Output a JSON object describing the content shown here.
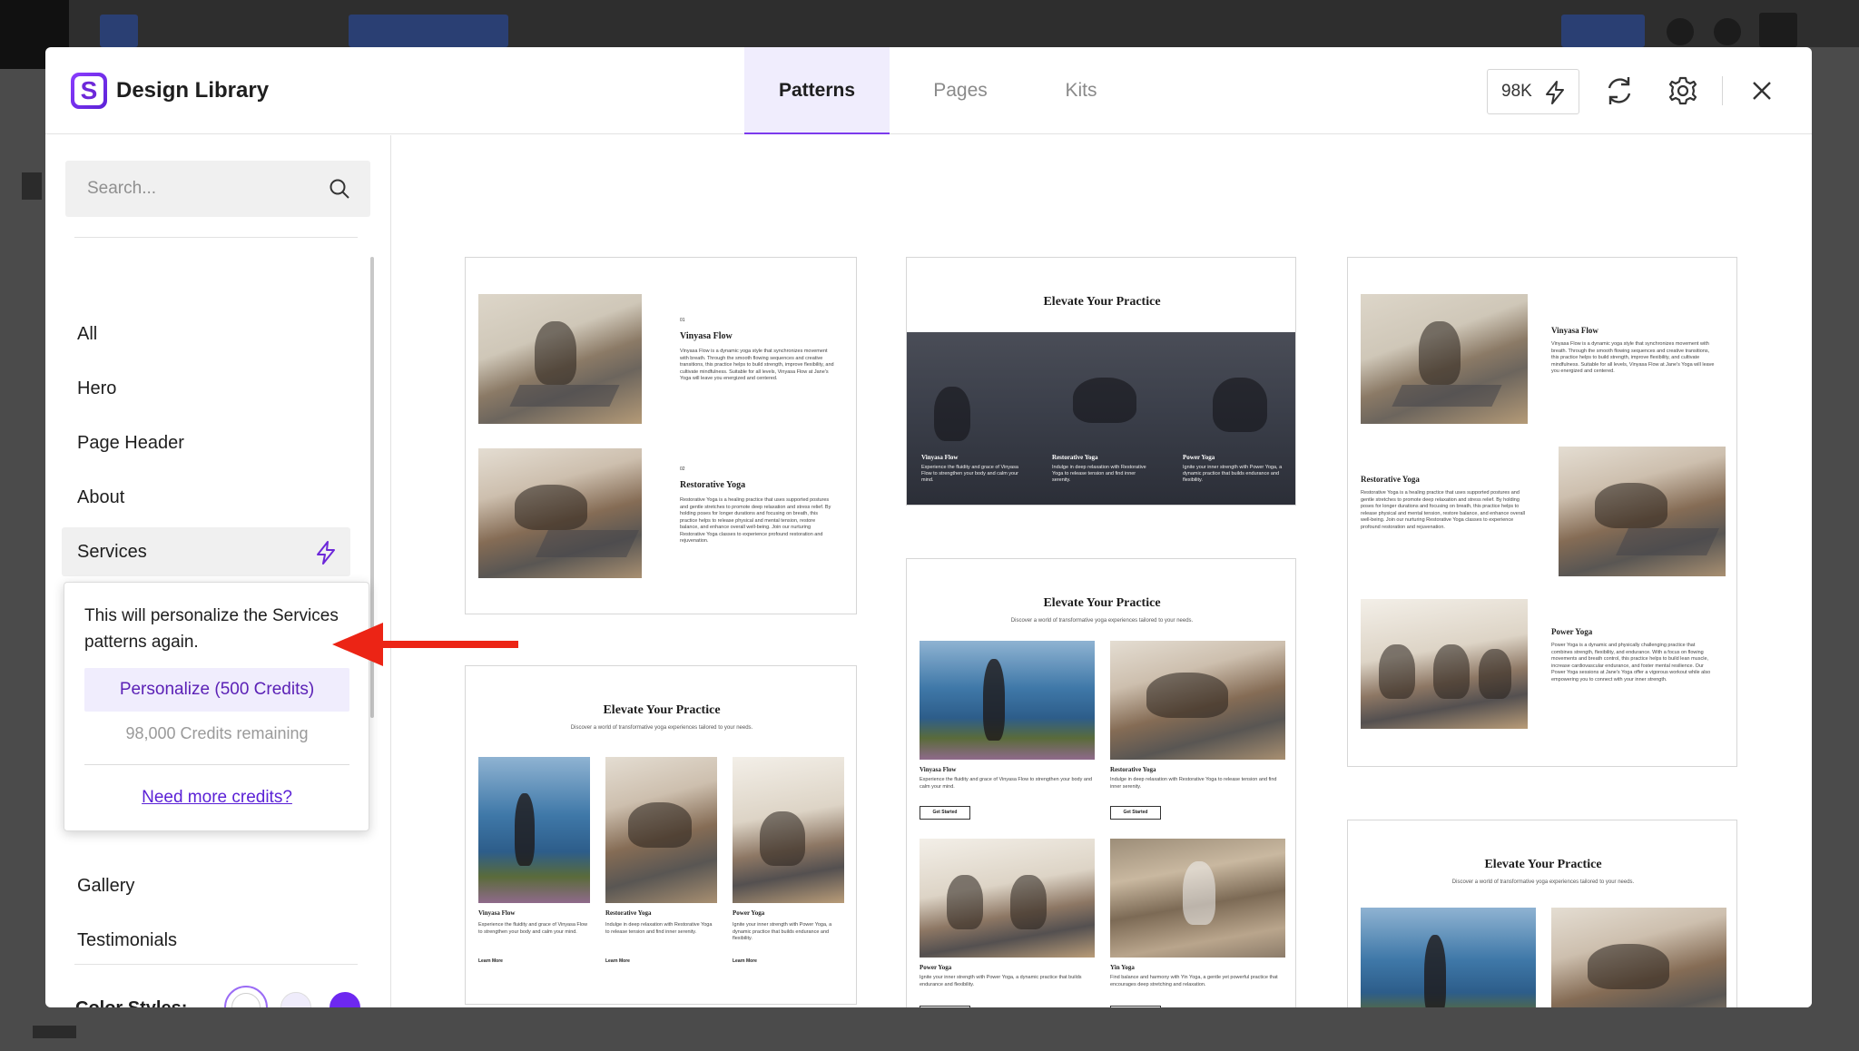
{
  "app": {
    "title": "Design Library",
    "logo_letter": "S",
    "tabs": [
      {
        "label": "Patterns",
        "active": true
      },
      {
        "label": "Pages",
        "active": false
      },
      {
        "label": "Kits",
        "active": false
      }
    ],
    "credits_short": "98K",
    "icons": {
      "credits": "lightning-icon",
      "sync": "refresh-icon",
      "settings": "gear-icon",
      "close": "close-icon"
    }
  },
  "sidebar": {
    "search_placeholder": "Search...",
    "categories": [
      {
        "label": "All"
      },
      {
        "label": "Hero"
      },
      {
        "label": "Page Header"
      },
      {
        "label": "About"
      },
      {
        "label": "Services",
        "active": true
      },
      {
        "label": "Gallery"
      },
      {
        "label": "Testimonials"
      }
    ],
    "popover": {
      "message": "This will personalize the Services patterns again.",
      "button": "Personalize (500 Credits)",
      "remaining": "98,000 Credits remaining",
      "link": "Need more credits?"
    },
    "color_styles_label": "Color Styles:",
    "swatches": [
      "#ffffff",
      "#efecfb",
      "#6d28f0"
    ]
  },
  "patterns": {
    "card1": {
      "items": [
        {
          "num": "01",
          "title": "Vinyasa Flow",
          "desc": "Vinyasa Flow is a dynamic yoga style that synchronizes movement with breath. Through the smooth flowing sequences and creative transitions, this practice helps to build strength, improve flexibility, and cultivate mindfulness. Suitable for all levels, Vinyasa Flow at Jane's Yoga will leave you energized and centered."
        },
        {
          "num": "02",
          "title": "Restorative Yoga",
          "desc": "Restorative Yoga is a healing practice that uses supported postures and gentle stretches to promote deep relaxation and stress relief. By holding poses for longer durations and focusing on breath, this practice helps to release physical and mental tension, restore balance, and enhance overall well-being. Join our nurturing Restorative Yoga classes to experience profound restoration and rejuvenation."
        }
      ]
    },
    "card2": {
      "title": "Elevate Your Practice",
      "items": [
        {
          "title": "Vinyasa Flow",
          "desc": "Experience the fluidity and grace of Vinyasa Flow to strengthen your body and calm your mind."
        },
        {
          "title": "Restorative Yoga",
          "desc": "Indulge in deep relaxation with Restorative Yoga to release tension and find inner serenity."
        },
        {
          "title": "Power Yoga",
          "desc": "Ignite your inner strength with Power Yoga, a dynamic practice that builds endurance and flexibility."
        }
      ]
    },
    "card3": {
      "items": [
        {
          "title": "Vinyasa Flow",
          "desc": "Vinyasa Flow is a dynamic yoga style that synchronizes movement with breath. Through the smooth flowing sequences and creative transitions, this practice helps to build strength, improve flexibility, and cultivate mindfulness. Suitable for all levels, Vinyasa Flow at Jane's Yoga will leave you energized and centered."
        },
        {
          "title": "Restorative Yoga",
          "desc": "Restorative Yoga is a healing practice that uses supported postures and gentle stretches to promote deep relaxation and stress relief. By holding poses for longer durations and focusing on breath, this practice helps to release physical and mental tension, restore balance, and enhance overall well-being. Join our nurturing Restorative Yoga classes to experience profound restoration and rejuvenation."
        },
        {
          "title": "Power Yoga",
          "desc": "Power Yoga is a dynamic and physically challenging practice that combines strength, flexibility, and endurance. With a focus on flowing movements and breath control, this practice helps to build lean muscle, increase cardiovascular endurance, and foster mental resilience. Our Power Yoga sessions at Jane's Yoga offer a vigorous workout while also empowering you to connect with your inner strength."
        }
      ]
    },
    "card4": {
      "title": "Elevate Your Practice",
      "subtitle": "Discover a world of transformative yoga experiences tailored to your needs.",
      "link_label": "Learn More",
      "items": [
        {
          "title": "Vinyasa Flow",
          "desc": "Experience the fluidity and grace of Vinyasa Flow to strengthen your body and calm your mind."
        },
        {
          "title": "Restorative Yoga",
          "desc": "Indulge in deep relaxation with Restorative Yoga to release tension and find inner serenity."
        },
        {
          "title": "Power Yoga",
          "desc": "Ignite your inner strength with Power Yoga, a dynamic practice that builds endurance and flexibility."
        }
      ]
    },
    "card5": {
      "title": "Elevate Your Practice",
      "subtitle": "Discover a world of transformative yoga experiences tailored to your needs.",
      "button_label": "Get Started",
      "items": [
        {
          "title": "Vinyasa Flow",
          "desc": "Experience the fluidity and grace of Vinyasa Flow to strengthen your body and calm your mind."
        },
        {
          "title": "Restorative Yoga",
          "desc": "Indulge in deep relaxation with Restorative Yoga to release tension and find inner serenity."
        },
        {
          "title": "Power Yoga",
          "desc": "Ignite your inner strength with Power Yoga, a dynamic practice that builds endurance and flexibility."
        },
        {
          "title": "Yin Yoga",
          "desc": "Find balance and harmony with Yin Yoga, a gentle yet powerful practice that encourages deep stretching and relaxation."
        }
      ]
    },
    "card6": {
      "title": "Elevate Your Practice",
      "subtitle": "Discover a world of transformative yoga experiences tailored to your needs."
    }
  }
}
